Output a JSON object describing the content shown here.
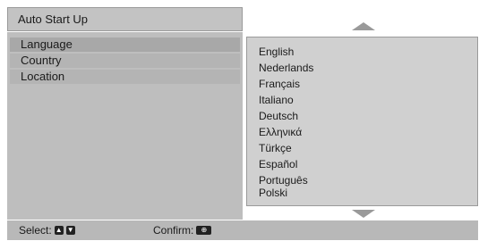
{
  "window": {
    "title": "Auto Start Up"
  },
  "menu": {
    "items": [
      {
        "label": "Language",
        "selected": true
      },
      {
        "label": "Country",
        "selected": false
      },
      {
        "label": "Location",
        "selected": false
      }
    ]
  },
  "language_list": {
    "options": [
      "English",
      "Nederlands",
      "Français",
      "Italiano",
      "Deutsch",
      "Ελληνικά",
      "Türkçe",
      "Español",
      "Português",
      "Polski"
    ]
  },
  "footer": {
    "select_label": "Select:",
    "confirm_label": "Confirm:",
    "icons": [
      "arrow-up-key-icon",
      "arrow-down-key-icon",
      "enter-key-icon"
    ]
  },
  "colors": {
    "panel": "#bebebe",
    "selected_item": "#a8a8a8",
    "list_panel": "#d0d0d0",
    "footer": "#b8b8b8"
  }
}
